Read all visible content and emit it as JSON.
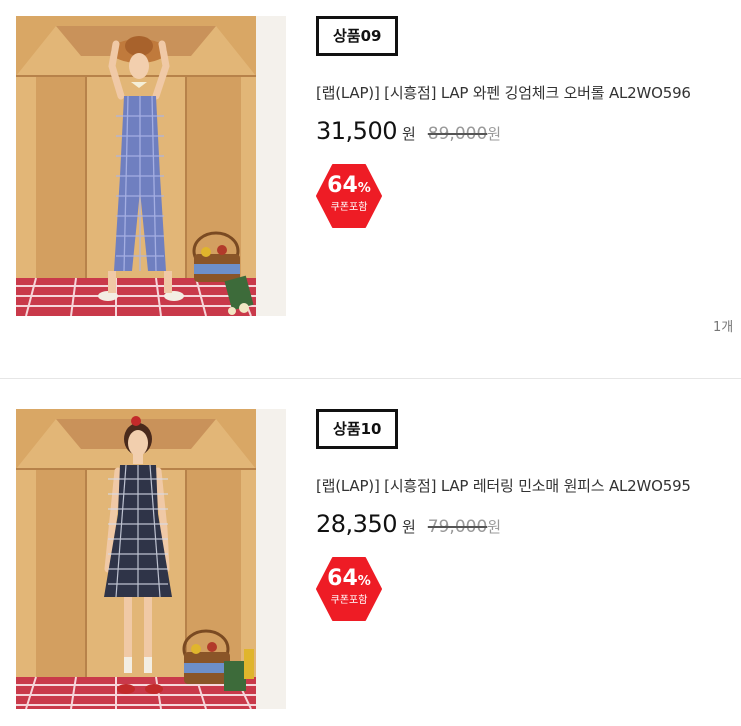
{
  "products": [
    {
      "rank": "상품09",
      "title": "[랩(LAP)] [시흥점] LAP 와펜 깅엄체크 오버롤 AL2WO596",
      "price": "31,500",
      "currency": "원",
      "original_price": "89,000",
      "original_currency": "원",
      "discount_value": "64",
      "discount_symbol": "%",
      "discount_caption": "쿠폰포함",
      "quantity": "1개",
      "image_subject": "model in blue gingham overall"
    },
    {
      "rank": "상품10",
      "title": "[랩(LAP)] [시흥점] LAP 레터링 민소매 원피스 AL2WO595",
      "price": "28,350",
      "currency": "원",
      "original_price": "79,000",
      "original_currency": "원",
      "discount_value": "64",
      "discount_symbol": "%",
      "discount_caption": "쿠폰포함",
      "image_subject": "model in black gingham sleeveless dress"
    }
  ],
  "colors": {
    "discount_badge": "#ee1c25",
    "badge_border": "#111111",
    "wall": "#d9a765",
    "floor_check": "#c9394a"
  }
}
